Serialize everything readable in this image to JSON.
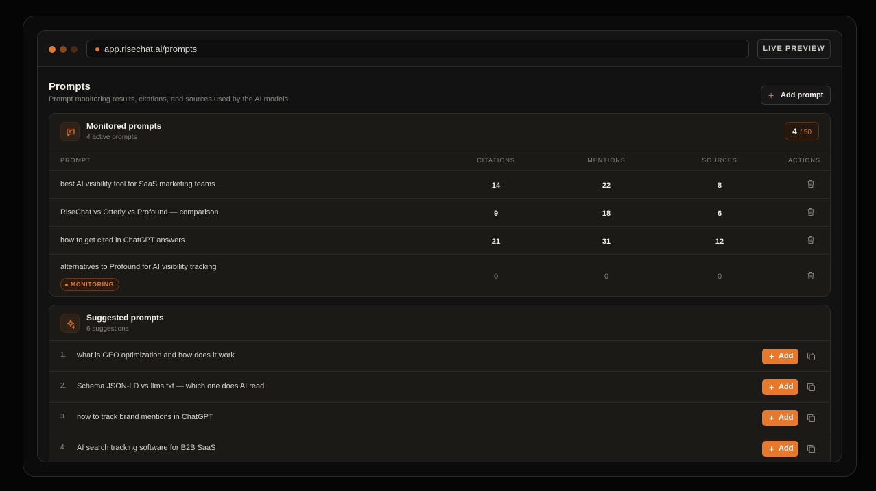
{
  "browser": {
    "url": "app.risechat.ai/prompts",
    "live_preview_label": "LIVE PREVIEW"
  },
  "page": {
    "title": "Prompts",
    "subtitle": "Prompt monitoring results, citations, and sources used by the AI models.",
    "add_prompt_label": "Add prompt"
  },
  "monitored": {
    "title": "Monitored prompts",
    "subtitle": "4 active prompts",
    "count_current": "4",
    "count_max": "/ 50",
    "columns": {
      "prompt": "PROMPT",
      "citations": "CITATIONS",
      "mentions": "MENTIONS",
      "sources": "SOURCES",
      "actions": "ACTIONS"
    },
    "rows": [
      {
        "prompt": "best AI visibility tool for SaaS marketing teams",
        "citations": "14",
        "mentions": "22",
        "sources": "8"
      },
      {
        "prompt": "RiseChat vs Otterly vs Profound — comparison",
        "citations": "9",
        "mentions": "18",
        "sources": "6"
      },
      {
        "prompt": "how to get cited in ChatGPT answers",
        "citations": "21",
        "mentions": "31",
        "sources": "12"
      },
      {
        "prompt": "alternatives to Profound for AI visibility tracking",
        "citations": "0",
        "mentions": "0",
        "sources": "0",
        "status": "MONITORING"
      }
    ]
  },
  "suggested": {
    "title": "Suggested prompts",
    "subtitle": "6 suggestions",
    "add_label": "Add",
    "items": [
      {
        "num": "1.",
        "text": "what is GEO optimization and how does it work"
      },
      {
        "num": "2.",
        "text": "Schema JSON-LD vs llms.txt — which one does AI read"
      },
      {
        "num": "3.",
        "text": "how to track brand mentions in ChatGPT"
      },
      {
        "num": "4.",
        "text": "AI search tracking software for B2B SaaS"
      }
    ]
  },
  "colors": {
    "accent": "#e8792b",
    "background": "#050505",
    "card": "#1b1a17"
  }
}
